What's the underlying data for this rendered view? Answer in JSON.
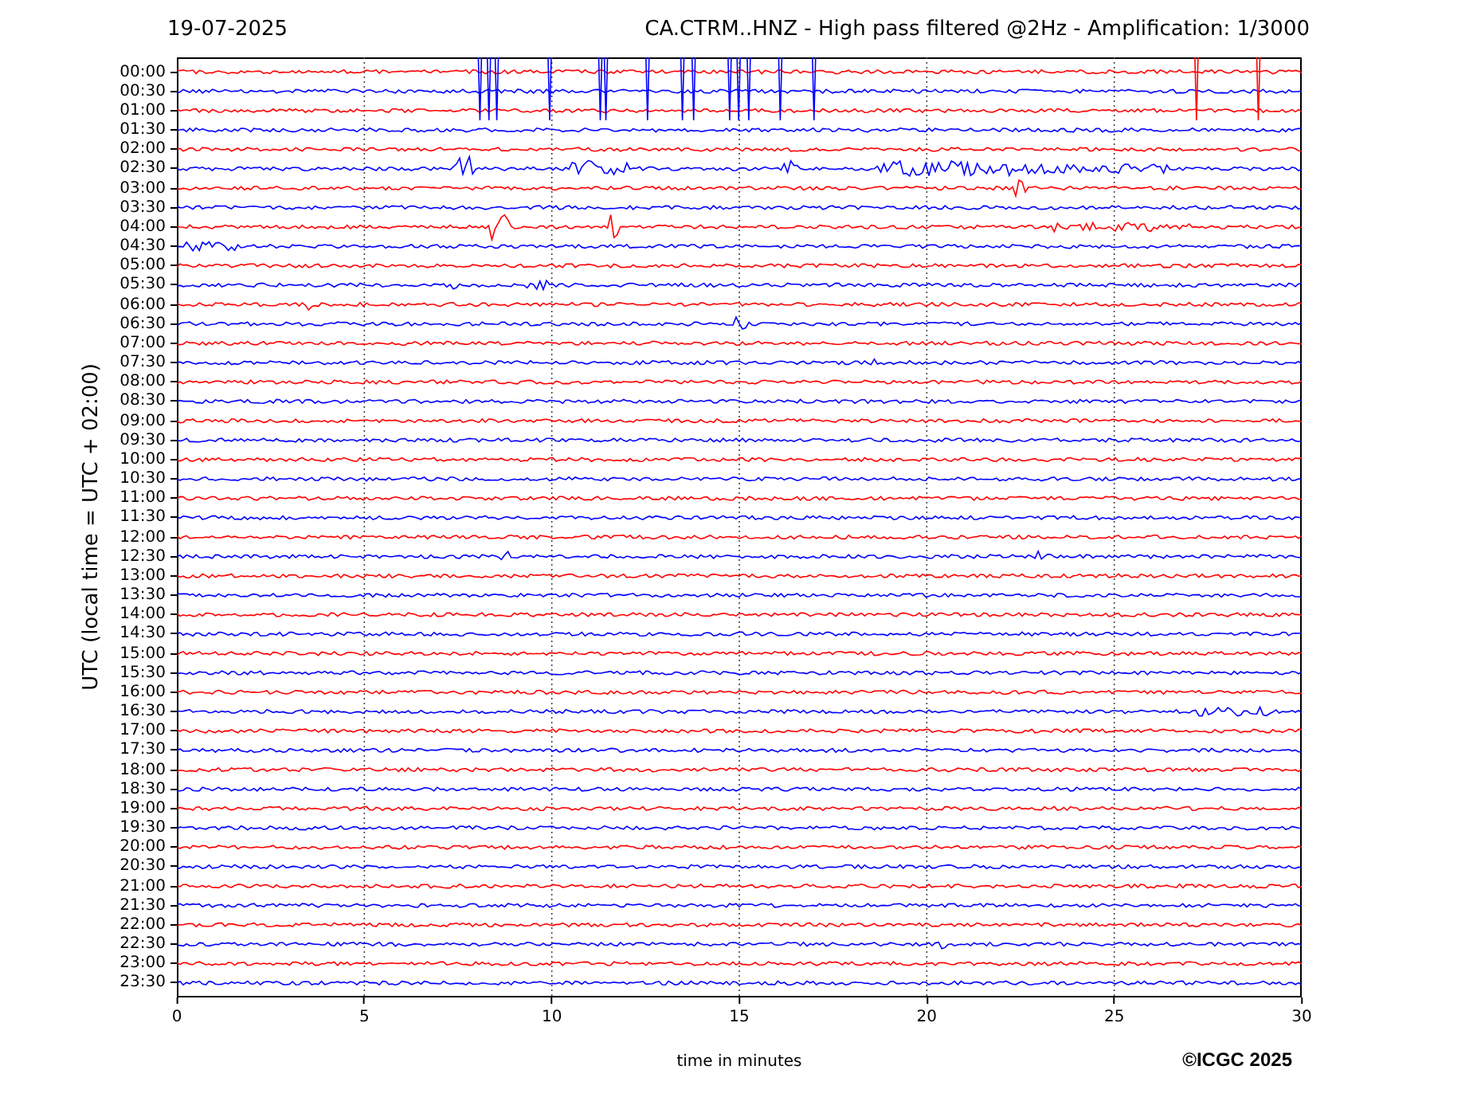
{
  "date": "19-07-2025",
  "title": "CA.CTRM..HNZ - High pass filtered @2Hz - Amplification: 1/3000",
  "ylabel": "UTC (local time = UTC + 02:00)",
  "xlabel": "time in minutes",
  "copyright": "©ICGC 2025",
  "xticks": [
    "0",
    "5",
    "10",
    "15",
    "20",
    "25",
    "30"
  ],
  "rows": [
    {
      "label": "00:00",
      "color": "#ff0000"
    },
    {
      "label": "00:30",
      "color": "#0000ff"
    },
    {
      "label": "01:00",
      "color": "#ff0000"
    },
    {
      "label": "01:30",
      "color": "#0000ff"
    },
    {
      "label": "02:00",
      "color": "#ff0000"
    },
    {
      "label": "02:30",
      "color": "#0000ff"
    },
    {
      "label": "03:00",
      "color": "#ff0000"
    },
    {
      "label": "03:30",
      "color": "#0000ff"
    },
    {
      "label": "04:00",
      "color": "#ff0000"
    },
    {
      "label": "04:30",
      "color": "#0000ff"
    },
    {
      "label": "05:00",
      "color": "#ff0000"
    },
    {
      "label": "05:30",
      "color": "#0000ff"
    },
    {
      "label": "06:00",
      "color": "#ff0000"
    },
    {
      "label": "06:30",
      "color": "#0000ff"
    },
    {
      "label": "07:00",
      "color": "#ff0000"
    },
    {
      "label": "07:30",
      "color": "#0000ff"
    },
    {
      "label": "08:00",
      "color": "#ff0000"
    },
    {
      "label": "08:30",
      "color": "#0000ff"
    },
    {
      "label": "09:00",
      "color": "#ff0000"
    },
    {
      "label": "09:30",
      "color": "#0000ff"
    },
    {
      "label": "10:00",
      "color": "#ff0000"
    },
    {
      "label": "10:30",
      "color": "#0000ff"
    },
    {
      "label": "11:00",
      "color": "#ff0000"
    },
    {
      "label": "11:30",
      "color": "#0000ff"
    },
    {
      "label": "12:00",
      "color": "#ff0000"
    },
    {
      "label": "12:30",
      "color": "#0000ff"
    },
    {
      "label": "13:00",
      "color": "#ff0000"
    },
    {
      "label": "13:30",
      "color": "#0000ff"
    },
    {
      "label": "14:00",
      "color": "#ff0000"
    },
    {
      "label": "14:30",
      "color": "#0000ff"
    },
    {
      "label": "15:00",
      "color": "#ff0000"
    },
    {
      "label": "15:30",
      "color": "#0000ff"
    },
    {
      "label": "16:00",
      "color": "#ff0000"
    },
    {
      "label": "16:30",
      "color": "#0000ff"
    },
    {
      "label": "17:00",
      "color": "#ff0000"
    },
    {
      "label": "17:30",
      "color": "#0000ff"
    },
    {
      "label": "18:00",
      "color": "#ff0000"
    },
    {
      "label": "18:30",
      "color": "#0000ff"
    },
    {
      "label": "19:00",
      "color": "#ff0000"
    },
    {
      "label": "19:30",
      "color": "#0000ff"
    },
    {
      "label": "20:00",
      "color": "#ff0000"
    },
    {
      "label": "20:30",
      "color": "#0000ff"
    },
    {
      "label": "21:00",
      "color": "#ff0000"
    },
    {
      "label": "21:30",
      "color": "#0000ff"
    },
    {
      "label": "22:00",
      "color": "#ff0000"
    },
    {
      "label": "22:30",
      "color": "#0000ff"
    },
    {
      "label": "23:00",
      "color": "#ff0000"
    },
    {
      "label": "23:30",
      "color": "#0000ff"
    }
  ]
}
